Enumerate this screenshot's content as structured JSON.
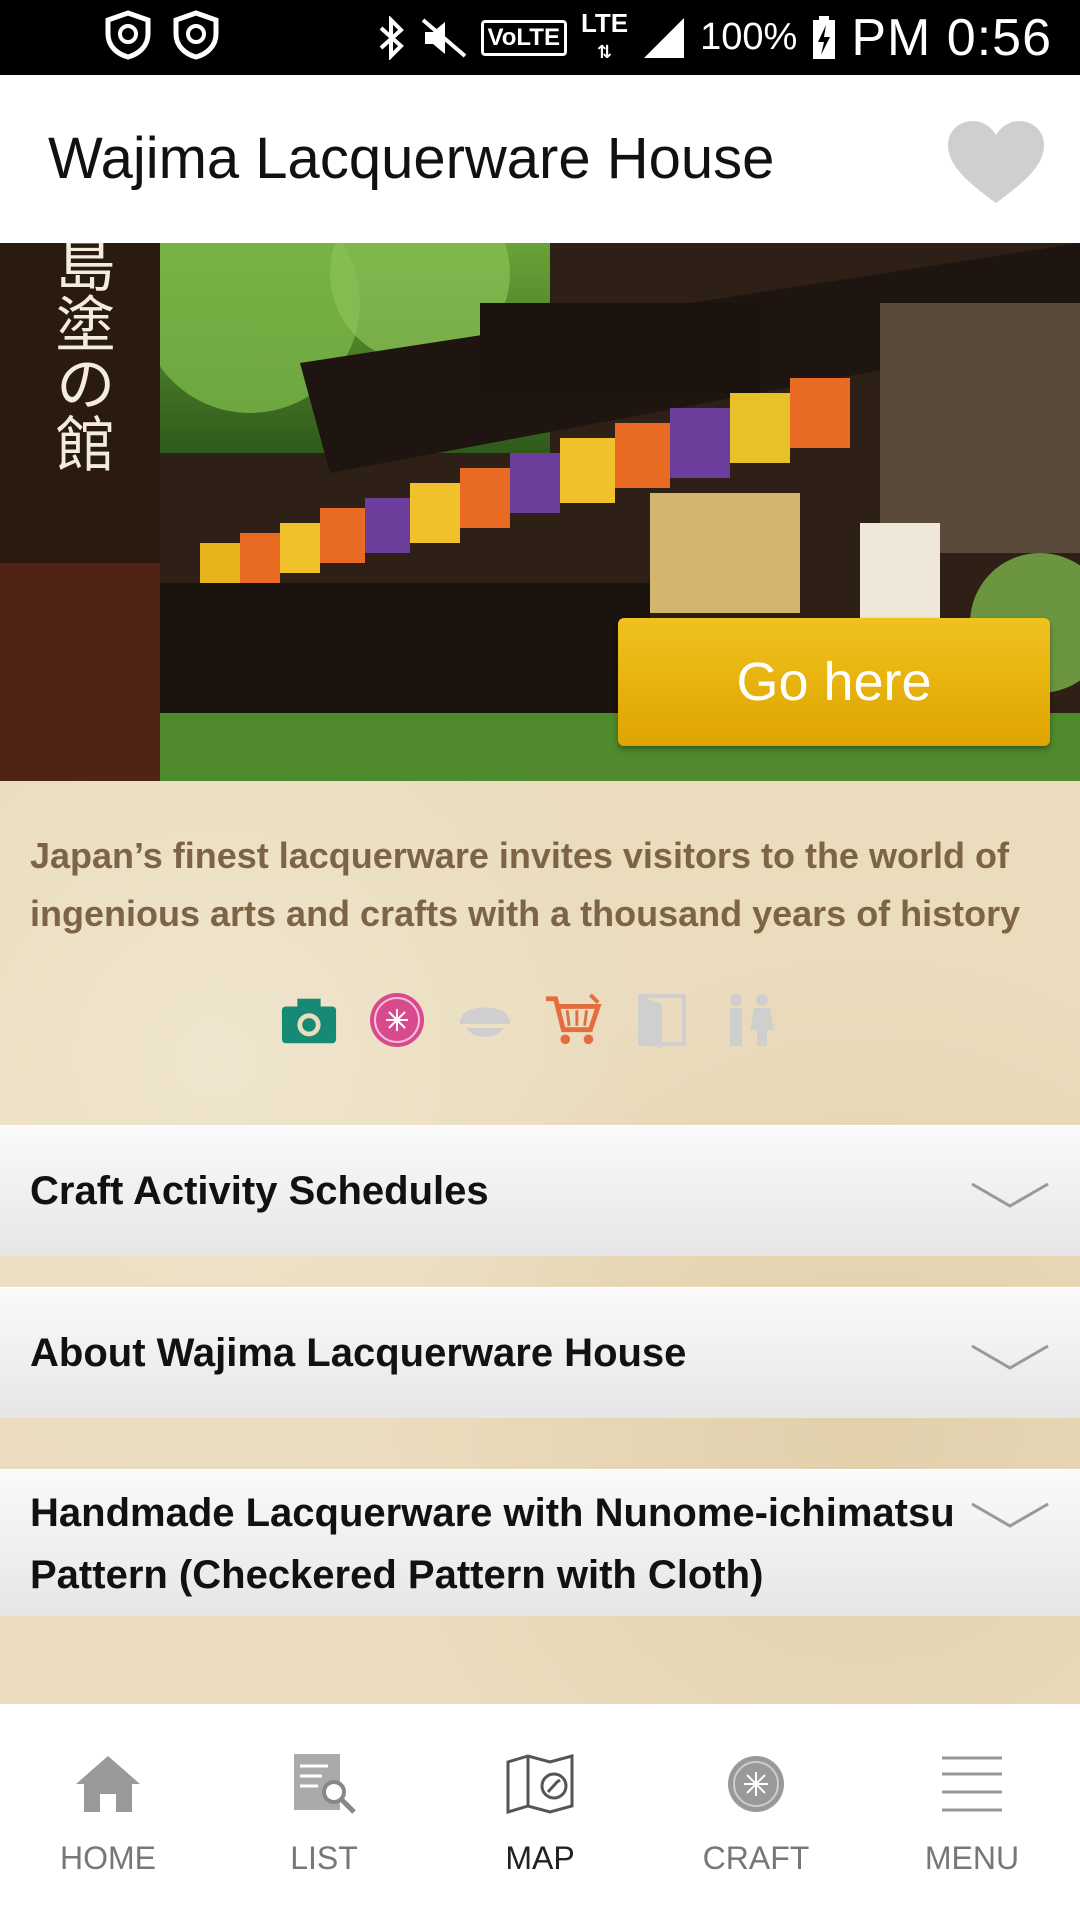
{
  "status_bar": {
    "battery": "100%",
    "time": "PM 0:56",
    "network": "LTE",
    "volte": "VoLTE"
  },
  "header": {
    "title": "Wajima Lacquerware House",
    "favorite_icon": "heart-icon"
  },
  "hero": {
    "image_text": "輪島塗の館",
    "go_button_label": "Go here"
  },
  "description": "Japan’s finest lacquerware invites visitors to the world of ingenious arts and crafts with a thousand years of history",
  "facility_icons": [
    {
      "name": "camera-icon",
      "color": "#168a75"
    },
    {
      "name": "craft-badge-icon",
      "color": "#d84a8c"
    },
    {
      "name": "food-icon",
      "color": "#cfcfcf"
    },
    {
      "name": "cart-icon",
      "color": "#e36d3e"
    },
    {
      "name": "door-icon",
      "color": "#cfcfcf"
    },
    {
      "name": "restroom-icon",
      "color": "#cfcfcf"
    }
  ],
  "accordions": [
    {
      "label": "Craft Activity Schedules"
    },
    {
      "label": "About Wajima Lacquerware House"
    },
    {
      "label": "Handmade Lacquerware with Nunome-ichimatsu Pattern (Checkered Pattern with Cloth)"
    }
  ],
  "bottom_nav": [
    {
      "label": "HOME",
      "icon": "home-icon"
    },
    {
      "label": "LIST",
      "icon": "list-search-icon"
    },
    {
      "label": "MAP",
      "icon": "map-icon",
      "active": true
    },
    {
      "label": "CRAFT",
      "icon": "craft-icon"
    },
    {
      "label": "MENU",
      "icon": "menu-icon"
    }
  ],
  "colors": {
    "accent_gold": "#e8b40f",
    "description_text": "#7d6447",
    "paper_bg": "#eadcbd"
  }
}
